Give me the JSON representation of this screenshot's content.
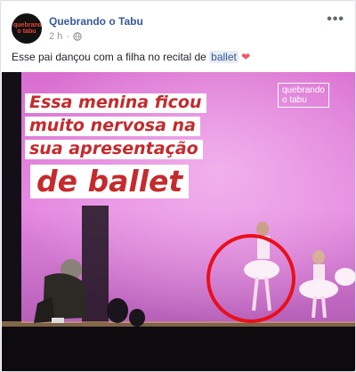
{
  "post": {
    "page_name": "Quebrando o Tabu",
    "timestamp": "2 h",
    "text_before": "Esse pai dançou com a filha no recital de ",
    "tag": "ballet",
    "heart": "❤",
    "more": "•••"
  },
  "avatar": {
    "text_line1": "quebrando",
    "text_line2": "o tabu"
  },
  "video": {
    "caption_line1": "Essa menina ficou",
    "caption_line2": "muito nervosa na",
    "caption_line3": "sua apresentação",
    "caption_line4": "de ballet",
    "watermark_line1": "quebrando",
    "watermark_line2": "o tabu"
  },
  "colors": {
    "link": "#365899",
    "caption_red": "#c52a2d",
    "circle_red": "#e8101b"
  }
}
